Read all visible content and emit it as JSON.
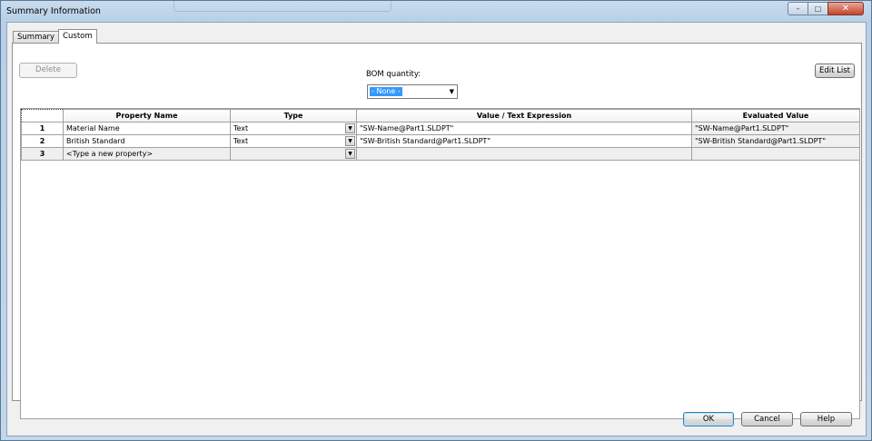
{
  "window": {
    "title": "Summary Information",
    "controls": {
      "minimize": "–",
      "maximize": "□",
      "close": "✕"
    }
  },
  "tabs": [
    {
      "label": "Summary",
      "active": false
    },
    {
      "label": "Custom",
      "active": true
    }
  ],
  "toolbar": {
    "delete_label": "Delete",
    "edit_list_label": "Edit List",
    "bom_quantity_label": "BOM quantity:",
    "bom_quantity_value": "- None -"
  },
  "grid": {
    "columns": [
      "Property Name",
      "Type",
      "Value / Text Expression",
      "Evaluated Value"
    ],
    "rows": [
      {
        "num": "1",
        "name": "Material Name",
        "type": "Text",
        "value": "\"SW-Name@Part1.SLDPT\"",
        "evaluated": "\"SW-Name@Part1.SLDPT\""
      },
      {
        "num": "2",
        "name": "British Standard",
        "type": "Text",
        "value": "\"SW-British Standard@Part1.SLDPT\"",
        "evaluated": "\"SW-British Standard@Part1.SLDPT\""
      },
      {
        "num": "3",
        "name": "<Type a new property>",
        "type": "",
        "value": "",
        "evaluated": ""
      }
    ]
  },
  "footer": {
    "ok_label": "OK",
    "cancel_label": "Cancel",
    "help_label": "Help"
  }
}
